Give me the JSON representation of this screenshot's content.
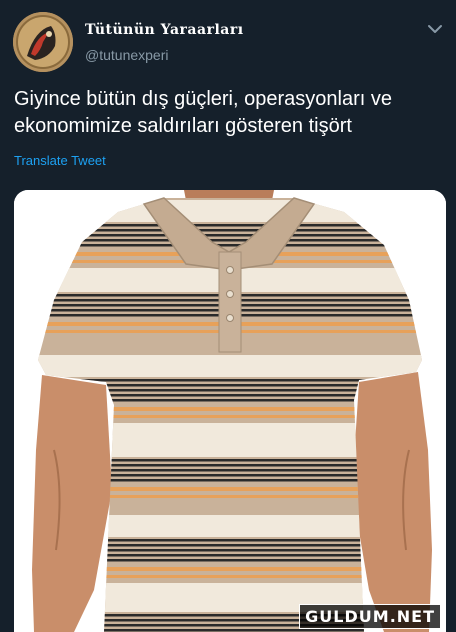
{
  "tweet": {
    "display_name": "Tütünün Yaraarları",
    "handle": "@tutunexperi",
    "text": "Giyince bütün dış güçleri, operasyonları ve ekonomimize saldırıları gösteren tişört",
    "translate_label": "Translate Tweet"
  },
  "media": {
    "description_icon": "striped-polo-shirt-photo"
  },
  "watermark": {
    "text": "GULDUM.NET"
  },
  "colors": {
    "background": "#15202b",
    "link": "#1da1f2",
    "secondary_text": "#8899a6",
    "shirt_base": "#c9b29a",
    "stripe_dark": "#2a2a2a",
    "stripe_orange": "#e7a15a",
    "stripe_cream": "#f1e9dc"
  }
}
